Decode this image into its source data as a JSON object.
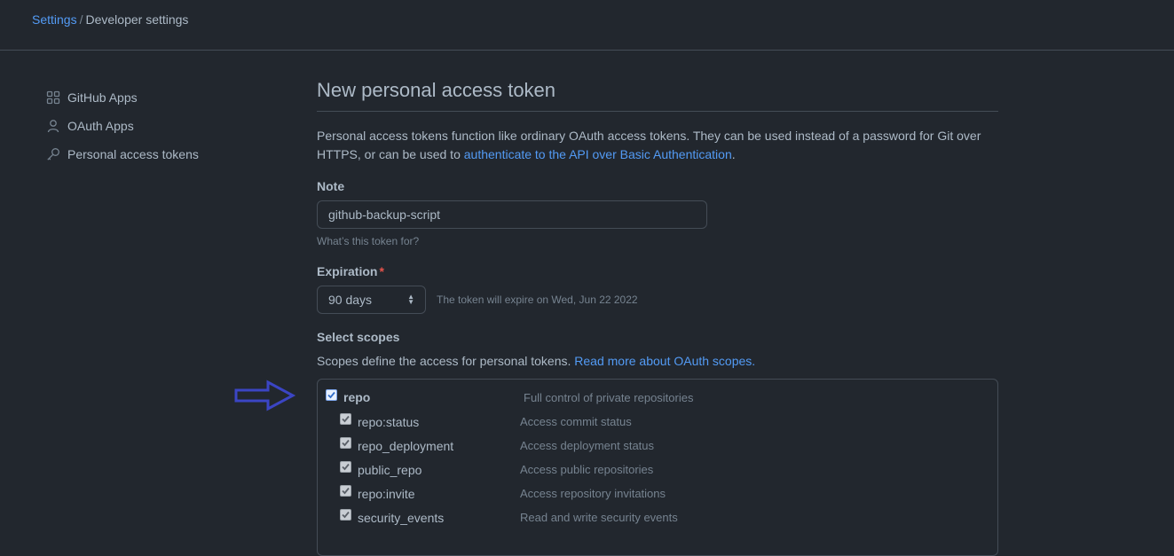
{
  "breadcrumb": {
    "settings": "Settings",
    "separator": "/",
    "current": "Developer settings"
  },
  "sidebar": {
    "items": [
      {
        "label": "GitHub Apps",
        "icon": "apps-grid-icon"
      },
      {
        "label": "OAuth Apps",
        "icon": "person-icon"
      },
      {
        "label": "Personal access tokens",
        "icon": "key-icon"
      }
    ]
  },
  "main": {
    "title": "New personal access token",
    "intro_text_1": "Personal access tokens function like ordinary OAuth access tokens. They can be used instead of a password for Git over HTTPS, or can be used to ",
    "intro_link": "authenticate to the API over Basic Authentication",
    "intro_text_2": ".",
    "note": {
      "label": "Note",
      "value": "github-backup-script",
      "help": "What’s this token for?"
    },
    "expiration": {
      "label": "Expiration",
      "required_mark": "*",
      "selected": "90 days",
      "note": "The token will expire on Wed, Jun 22 2022"
    },
    "scopes": {
      "label": "Select scopes",
      "desc": "Scopes define the access for personal tokens. ",
      "desc_link": "Read more about OAuth scopes.",
      "items": [
        {
          "name": "repo",
          "desc": "Full control of private repositories",
          "checked": true,
          "level": 0
        },
        {
          "name": "repo:status",
          "desc": "Access commit status",
          "checked": true,
          "level": 1
        },
        {
          "name": "repo_deployment",
          "desc": "Access deployment status",
          "checked": true,
          "level": 1
        },
        {
          "name": "public_repo",
          "desc": "Access public repositories",
          "checked": true,
          "level": 1
        },
        {
          "name": "repo:invite",
          "desc": "Access repository invitations",
          "checked": true,
          "level": 1
        },
        {
          "name": "security_events",
          "desc": "Read and write security events",
          "checked": true,
          "level": 1
        }
      ]
    }
  },
  "colors": {
    "background": "#22272e",
    "link": "#539bf5",
    "border": "#444c56",
    "annotation_arrow": "#3b45c4"
  }
}
